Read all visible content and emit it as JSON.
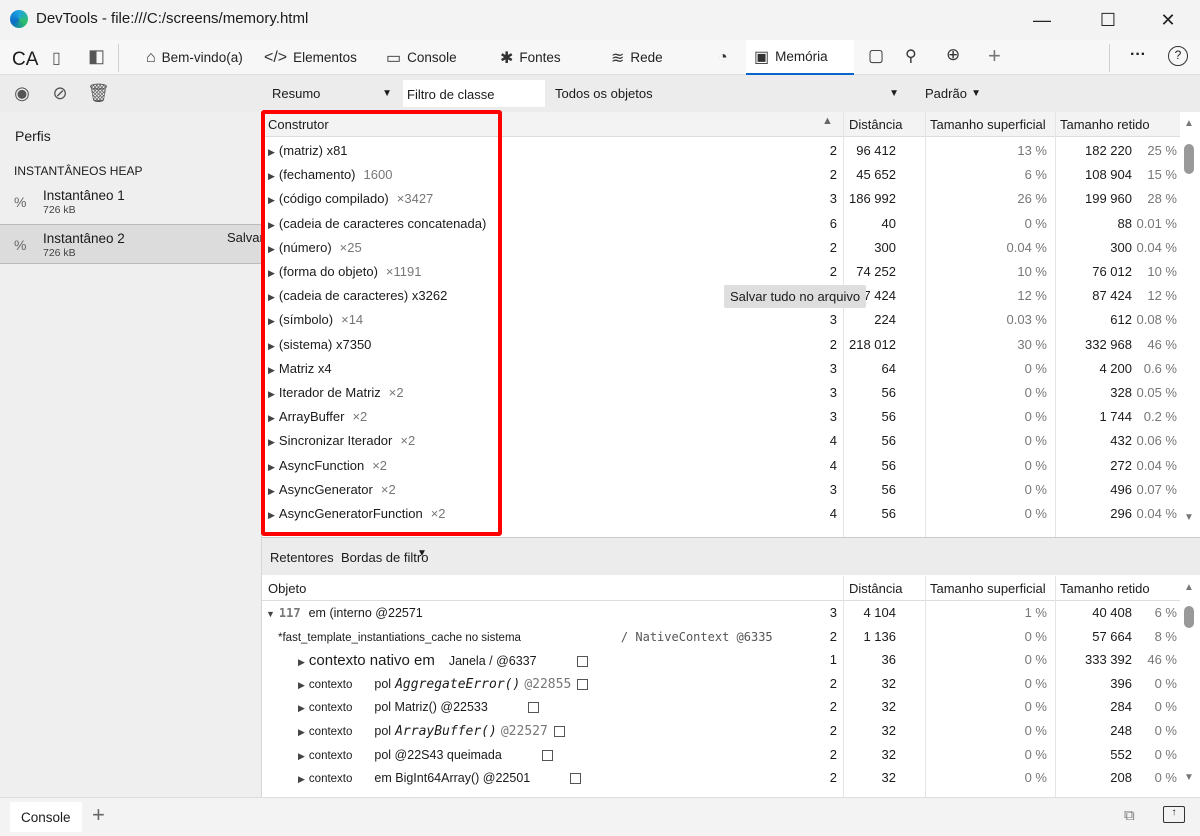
{
  "window": {
    "title": "DevTools - file:///C:/screens/memory.html",
    "minimize": "—",
    "maximize": "☐",
    "close": "✕"
  },
  "tabbar": {
    "ca": "CA",
    "tabs": [
      {
        "label": "Bem-vindo(a)",
        "icon": "home-icon",
        "glyph": "⌂"
      },
      {
        "label": "Elementos",
        "icon": "code-icon",
        "glyph": "</>"
      },
      {
        "label": "Console",
        "icon": "console-icon",
        "glyph": "▭"
      },
      {
        "label": "Fontes",
        "icon": "bug-icon",
        "glyph": "✱"
      },
      {
        "label": "Rede",
        "icon": "wifi-icon",
        "glyph": "≋"
      },
      {
        "label": "",
        "icon": "performance-icon",
        "glyph": "◔"
      },
      {
        "label": "Memória",
        "icon": "memory-chip-icon",
        "glyph": "▣",
        "active": true
      }
    ],
    "more": "···",
    "help": "?",
    "add": "+"
  },
  "toolbar": {
    "view": "Resumo",
    "class_filter_placeholder": "Filtro de classe",
    "objects": "Todos os objetos",
    "grouping": "Padrão"
  },
  "sidebar": {
    "profiles": "Perfis",
    "section": "INSTANTÂNEOS HEAP",
    "snapshots": [
      {
        "name": "Instantâneo 1",
        "size": "726 kB"
      },
      {
        "name": "Instantâneo 2",
        "size": "726 kB",
        "save": "Salvar",
        "selected": true
      }
    ]
  },
  "upper": {
    "headers": {
      "constructor": "Construtor",
      "distance": "Distância",
      "shallow": "Tamanho superficial",
      "retained": "Tamanho retido"
    },
    "save_all": "Salvar tudo no arquivo",
    "rows": [
      {
        "name": "(matriz) x81",
        "count": "",
        "d": "2",
        "s": "96 412",
        "sp": "13 %",
        "r": "182 220",
        "rp": "25 %"
      },
      {
        "name": "(fechamento)",
        "count": "1600",
        "d": "2",
        "s": "45 652",
        "sp": "6 %",
        "r": "108 904",
        "rp": "15 %"
      },
      {
        "name": "(código compilado)",
        "count": "×3427",
        "d": "3",
        "s": "186 992",
        "sp": "26 %",
        "r": "199 960",
        "rp": "28 %"
      },
      {
        "name": "(cadeia de caracteres concatenada)",
        "count": "",
        "d": "6",
        "s": "40",
        "sp": "0 %",
        "r": "88",
        "rp": "0.01 %"
      },
      {
        "name": "(número)",
        "count": "×25",
        "d": "2",
        "s": "300",
        "sp": "0.04 %",
        "r": "300",
        "rp": "0.04 %"
      },
      {
        "name": "(forma do objeto)",
        "count": "×1191",
        "d": "2",
        "s": "74 252",
        "sp": "10 %",
        "r": "76 012",
        "rp": "10 %"
      },
      {
        "name": "(cadeia de caracteres) x3262",
        "count": "",
        "d": "3",
        "s": "87 424",
        "sp": "12 %",
        "r": "87 424",
        "rp": "12 %"
      },
      {
        "name": "(símbolo)",
        "count": "×14",
        "d": "3",
        "s": "224",
        "sp": "0.03 %",
        "r": "612",
        "rp": "0.08 %"
      },
      {
        "name": "(sistema) x7350",
        "count": "",
        "d": "2",
        "s": "218 012",
        "sp": "30 %",
        "r": "332 968",
        "rp": "46 %"
      },
      {
        "name": "Matriz x4",
        "count": "",
        "d": "3",
        "s": "64",
        "sp": "0 %",
        "r": "4 200",
        "rp": "0.6 %"
      },
      {
        "name": "Iterador de Matriz",
        "count": "×2",
        "d": "3",
        "s": "56",
        "sp": "0 %",
        "r": "328",
        "rp": "0.05 %"
      },
      {
        "name": "ArrayBuffer",
        "count": "×2",
        "d": "3",
        "s": "56",
        "sp": "0 %",
        "r": "1 744",
        "rp": "0.2 %"
      },
      {
        "name": "Sincronizar Iterador",
        "count": "×2",
        "d": "4",
        "s": "56",
        "sp": "0 %",
        "r": "432",
        "rp": "0.06 %"
      },
      {
        "name": "AsyncFunction",
        "count": "×2",
        "d": "4",
        "s": "56",
        "sp": "0 %",
        "r": "272",
        "rp": "0.04 %"
      },
      {
        "name": "AsyncGenerator",
        "count": "×2",
        "d": "3",
        "s": "56",
        "sp": "0 %",
        "r": "496",
        "rp": "0.07 %"
      },
      {
        "name": "AsyncGeneratorFunction",
        "count": "×2",
        "d": "4",
        "s": "56",
        "sp": "0 %",
        "r": "296",
        "rp": "0.04 %"
      }
    ]
  },
  "lower": {
    "tabs": {
      "retainers": "Retentores",
      "filter": "Bordas de filtro"
    },
    "headers": {
      "object": "Objeto",
      "distance": "Distância",
      "shallow": "Tamanho superficial",
      "retained": "Tamanho retido"
    },
    "rows": [
      {
        "indent": 0,
        "tri": "▼",
        "pre": "117",
        "text": "em (interno @22571",
        "mono": "",
        "id": "",
        "chk": false,
        "d": "3",
        "s": "4 104",
        "sp": "1 %",
        "r": "40 408",
        "rp": "6 %"
      },
      {
        "indent": 1,
        "tri": "",
        "pre": "",
        "text": "*fast_template_instantiations_cache no sistema",
        "mono": "/ NativeContext @6335",
        "id": "",
        "chk": false,
        "d": "2",
        "s": "1 136",
        "sp": "0 %",
        "r": "57 664",
        "rp": "8 %"
      },
      {
        "indent": 2,
        "tri": "▶",
        "pre": "contexto nativo em",
        "text": "Janela / @6337",
        "mono": "",
        "id": "",
        "chk": true,
        "d": "1",
        "s": "36",
        "sp": "0 %",
        "r": "333 392",
        "rp": "46 %"
      },
      {
        "indent": 2,
        "tri": "▶",
        "pre": "contexto",
        "text": "pol",
        "mono": "AggregateError()",
        "id": "@22855",
        "chk": true,
        "d": "2",
        "s": "32",
        "sp": "0 %",
        "r": "396",
        "rp": "0 %"
      },
      {
        "indent": 2,
        "tri": "▶",
        "pre": "contexto",
        "text": "pol Matriz() @22533",
        "mono": "",
        "id": "",
        "chk": true,
        "d": "2",
        "s": "32",
        "sp": "0 %",
        "r": "284",
        "rp": "0 %"
      },
      {
        "indent": 2,
        "tri": "▶",
        "pre": "contexto",
        "text": "pol",
        "mono": "ArrayBuffer()",
        "id": "@22527",
        "chk": true,
        "d": "2",
        "s": "32",
        "sp": "0 %",
        "r": "248",
        "rp": "0 %"
      },
      {
        "indent": 2,
        "tri": "▶",
        "pre": "contexto",
        "text": "pol @22S43 queimada",
        "mono": "",
        "id": "",
        "chk": true,
        "d": "2",
        "s": "32",
        "sp": "0 %",
        "r": "552",
        "rp": "0 %"
      },
      {
        "indent": 2,
        "tri": "▶",
        "pre": "contexto",
        "text": "em BigInt64Array() @22501",
        "mono": "",
        "id": "",
        "chk": true,
        "d": "2",
        "s": "32",
        "sp": "0 %",
        "r": "208",
        "rp": "0 %"
      }
    ]
  },
  "drawer": {
    "console": "Console",
    "add": "+"
  },
  "colors": {
    "accent": "#0a64c9",
    "highlight": "#ff0000"
  }
}
